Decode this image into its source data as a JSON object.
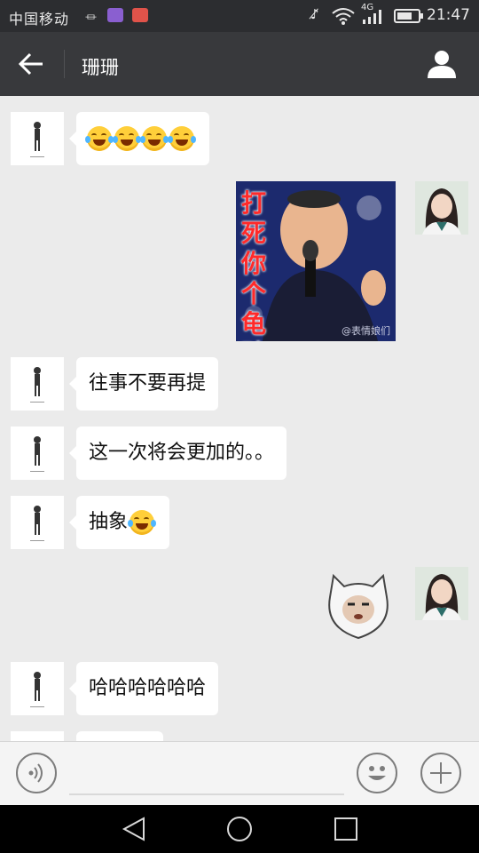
{
  "status_bar": {
    "carrier": "中国移动",
    "network": "4G",
    "time": "21:47"
  },
  "header": {
    "title": "珊珊",
    "back_icon": "arrow-left-icon",
    "profile_icon": "person-icon"
  },
  "messages": [
    {
      "side": "left",
      "type": "emoji",
      "count": 4
    },
    {
      "side": "right",
      "type": "sticker",
      "sticker_text": "打死你个龟孙",
      "watermark": "@表情娘们"
    },
    {
      "side": "left",
      "type": "text",
      "text": "往事不要再提"
    },
    {
      "side": "left",
      "type": "text",
      "text": "这一次将会更加的。。"
    },
    {
      "side": "left",
      "type": "text",
      "text": "抽象"
    },
    {
      "side": "right",
      "type": "sticker-face"
    },
    {
      "side": "left",
      "type": "text",
      "text": "哈哈哈哈哈哈"
    }
  ],
  "input_bar": {
    "voice_icon": "voice-icon",
    "emoji_icon": "smiley-icon",
    "plus_icon": "plus-icon"
  },
  "nav": {
    "back_icon": "triangle-back-icon",
    "home_icon": "circle-home-icon",
    "recent_icon": "square-recent-icon"
  },
  "colors": {
    "header_bg": "#38393c",
    "chat_bg": "#ebebeb",
    "bubble_left": "#ffffff"
  }
}
